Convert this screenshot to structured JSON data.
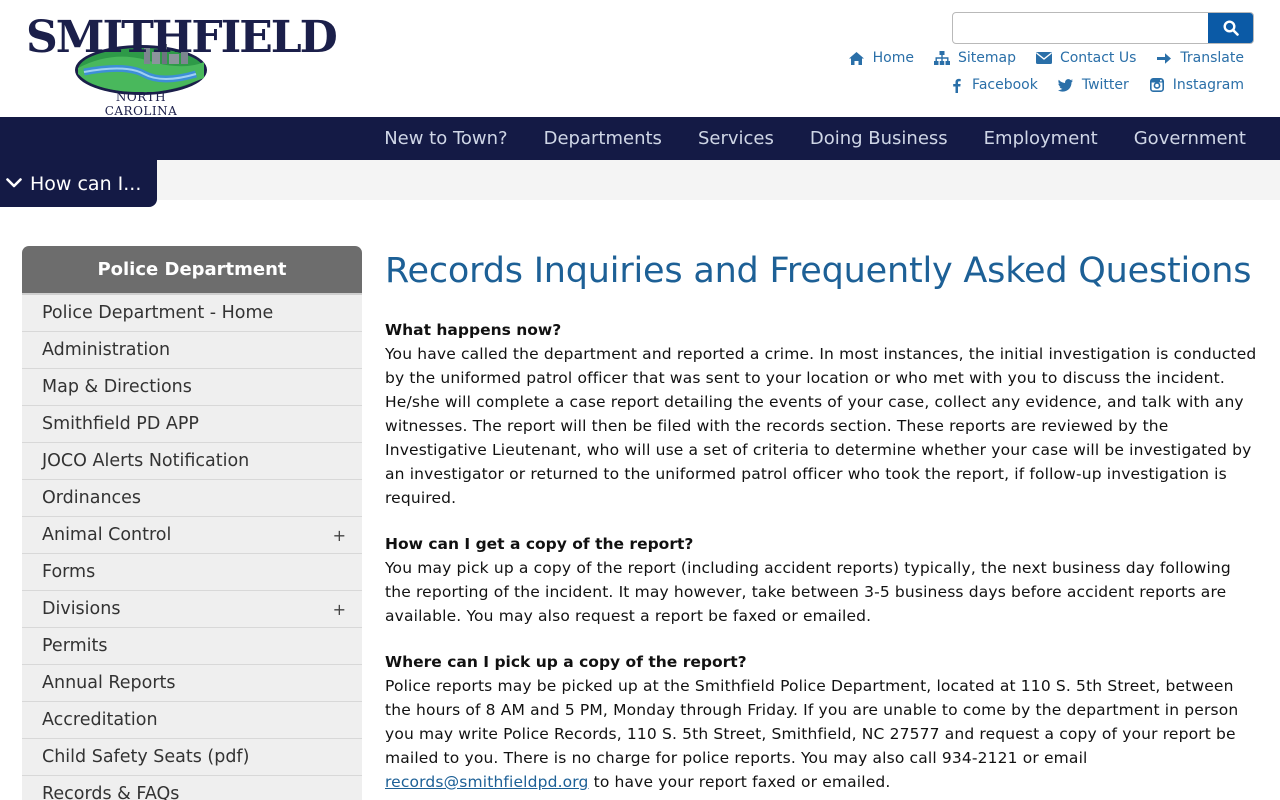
{
  "header": {
    "logo_text": "SMITHFIELD",
    "logo_subtitle": "NORTH CAROLINA",
    "search": {
      "placeholder": "",
      "value": ""
    },
    "utility_links": [
      {
        "label": "Home",
        "icon": "home-icon"
      },
      {
        "label": "Sitemap",
        "icon": "sitemap-icon"
      },
      {
        "label": "Contact Us",
        "icon": "envelope-icon"
      },
      {
        "label": "Translate",
        "icon": "arrow-right-icon"
      }
    ],
    "social_links": [
      {
        "label": "Facebook",
        "icon": "facebook-icon"
      },
      {
        "label": "Twitter",
        "icon": "twitter-icon"
      },
      {
        "label": "Instagram",
        "icon": "instagram-icon"
      }
    ]
  },
  "nav": {
    "items": [
      "New to Town?",
      "Departments",
      "Services",
      "Doing Business",
      "Employment",
      "Government"
    ]
  },
  "howcan": {
    "label": "How can I..."
  },
  "sidebar": {
    "title": "Police Department",
    "items": [
      {
        "label": "Police Department - Home",
        "expandable": false
      },
      {
        "label": "Administration",
        "expandable": false
      },
      {
        "label": "Map & Directions",
        "expandable": false
      },
      {
        "label": "Smithfield PD APP",
        "expandable": false
      },
      {
        "label": "JOCO Alerts Notification",
        "expandable": false
      },
      {
        "label": "Ordinances",
        "expandable": false
      },
      {
        "label": "Animal Control",
        "expandable": true
      },
      {
        "label": "Forms",
        "expandable": false
      },
      {
        "label": "Divisions",
        "expandable": true
      },
      {
        "label": "Permits",
        "expandable": false
      },
      {
        "label": "Annual Reports",
        "expandable": false
      },
      {
        "label": "Accreditation",
        "expandable": false
      },
      {
        "label": "Child Safety Seats (pdf)",
        "expandable": false
      },
      {
        "label": "Records & FAQs",
        "expandable": false
      }
    ],
    "expand_symbol": "+"
  },
  "main": {
    "title": "Records Inquiries and Frequently Asked Questions",
    "sections": [
      {
        "question": "What happens now?",
        "answer": "You have called the department and reported a crime. In most instances, the initial investigation is conducted by the uniformed patrol officer that was sent to your location or who met with you to discuss the incident. He/she will complete a case report detailing the events of your case, collect any evidence, and talk with any witnesses. The report will then be filed with the records section. These reports are reviewed by the Investigative Lieutenant, who will use a set of criteria to determine whether your case will be investigated by an investigator or returned to the uniformed patrol officer who took the report, if follow-up investigation is required."
      },
      {
        "question": "How can I get a copy of the report?",
        "answer": "You may pick up a copy of the report (including accident reports) typically, the next business day following the reporting of the incident. It may however, take between 3-5 business days before accident reports are available. You may also request a report be faxed or emailed."
      },
      {
        "question": "Where can I pick up a copy of the report?",
        "answer": "Police reports may be picked up at the Smithfield Police Department, located at 110 S. 5th Street, between the hours of 8 AM and 5 PM, Monday through Friday. If you are unable to come by the department in person you may write Police Records, 110 S. 5th Street, Smithfield, NC 27577 and request a copy of your report be mailed to you. There is no charge for police reports. You may also call 934-2121 or email",
        "email": "records@smithfieldpd.org",
        "answer_tail": " to have your report faxed or emailed."
      }
    ]
  },
  "colors": {
    "nav_bg": "#141a45",
    "link_blue": "#1d6096",
    "sidebar_header": "#6d6d6d",
    "search_button": "#0b5aa6"
  }
}
